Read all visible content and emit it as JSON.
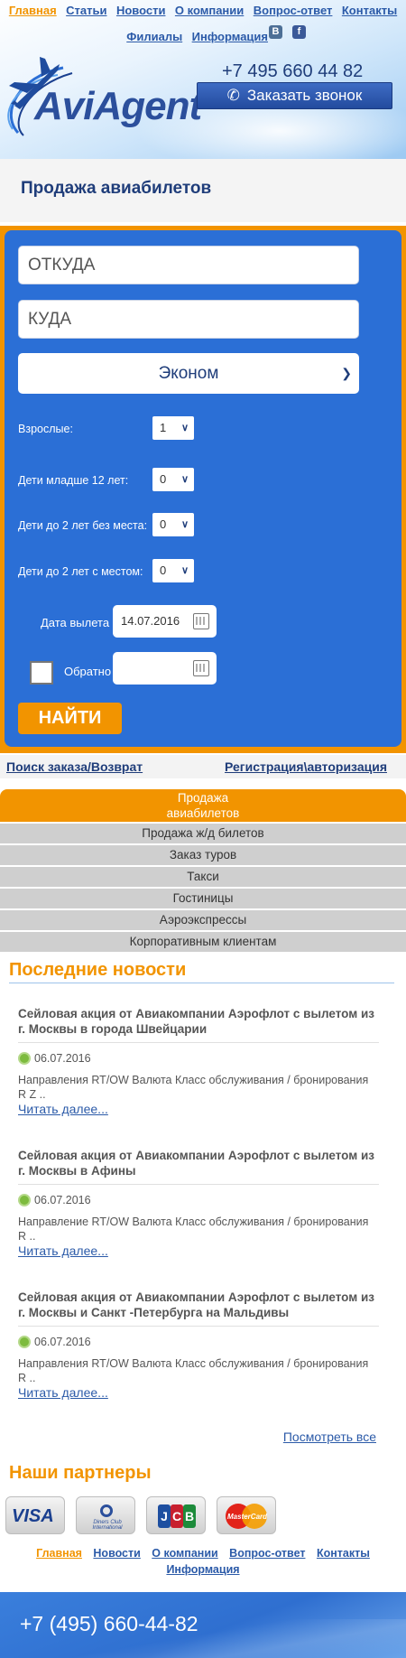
{
  "topnav": {
    "links": [
      "Главная",
      "Статьи",
      "Новости",
      "О компании",
      "Вопрос-ответ",
      "Контакты"
    ],
    "links2": [
      "Филиалы",
      "Информация"
    ],
    "vk": "B",
    "fb": "f"
  },
  "header": {
    "logo_text": "AviAgent",
    "phone": "+7 495 660 44 82",
    "callback_label": "Заказать звонок"
  },
  "page_title": "Продажа авиабилетов",
  "form": {
    "from_placeholder": "ОТКУДА",
    "to_placeholder": "КУДА",
    "class_value": "Эконом",
    "adults_label": "Взрослые:",
    "adults_value": "1",
    "children_label": "Дети младше 12 лет:",
    "children_value": "0",
    "infants_noseat_label": "Дети до 2 лет без места:",
    "infants_noseat_value": "0",
    "infants_seat_label": "Дети до 2 лет с местом:",
    "infants_seat_value": "0",
    "depart_label": "Дата вылета",
    "depart_value": "14.07.2016",
    "return_label": "Обратно",
    "search_label": "НАЙТИ"
  },
  "sublinks": {
    "left": "Поиск заказа/Возврат",
    "right": "Регистрация\\авторизация"
  },
  "menu": [
    "Продажа\nавиабилетов",
    "Продажа ж/д билетов",
    "Заказ туров",
    "Такси",
    "Гостиницы",
    "Аэроэкспрессы",
    "Корпоративным клиентам"
  ],
  "news_title": "Последние новости",
  "news": [
    {
      "title": "Сейловая акция от Авиакомпании Аэрофлот с вылетом из г. Москвы в города Швейцарии",
      "date": "06.07.2016",
      "text": "Направления RT/OW Валюта Класс обслуживания / бронирования R Z ..",
      "more": "Читать далее..."
    },
    {
      "title": "Сейловая акция от Авиакомпании Аэрофлот с вылетом из г. Москвы в Афины",
      "date": "06.07.2016",
      "text": "Направление RT/OW Валюта Класс обслуживания / бронирования R    ..",
      "more": "Читать далее..."
    },
    {
      "title": "Сейловая акция от Авиакомпании Аэрофлот с вылетом из г. Москвы и Санкт -Петербурга на Мальдивы",
      "date": "06.07.2016",
      "text": "Направления RT/OW Валюта Класс обслуживания / бронирования R    ..",
      "more": "Читать далее..."
    }
  ],
  "see_all": "Посмотреть все",
  "partners_title": "Наши партнеры",
  "partners": {
    "visa": "VISA",
    "diners": "Diners Club International",
    "jcb": [
      "J",
      "C",
      "B"
    ],
    "mastercard": "MasterCard"
  },
  "footnav": [
    "Главная",
    "Новости",
    "О компании",
    "Вопрос-ответ",
    "Контакты",
    "Информация"
  ],
  "footer_phone": "+7 (495) 660-44-82",
  "colors": {
    "accent": "#f29400",
    "primary": "#2b6fd6",
    "dark_blue": "#1f3d7a"
  }
}
